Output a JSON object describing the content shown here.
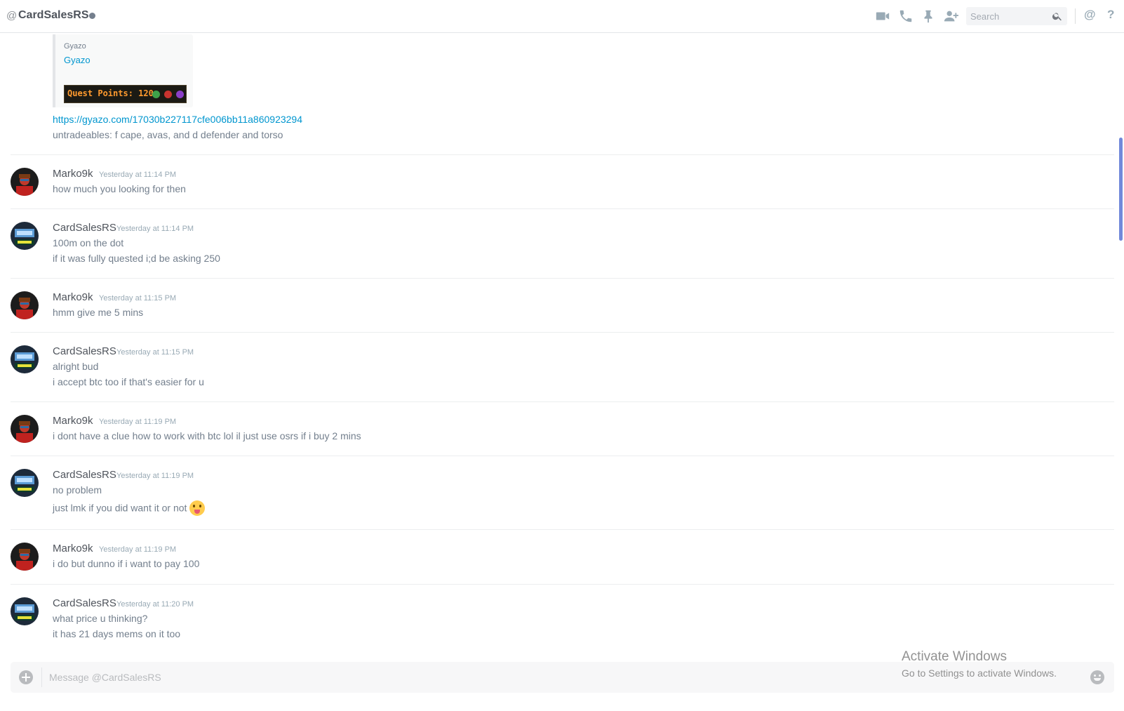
{
  "header": {
    "at_symbol": "@",
    "channel_name": "CardSalesRS",
    "search_placeholder": "Search",
    "mention_symbol": "@",
    "help_symbol": "?"
  },
  "embed": {
    "provider": "Gyazo",
    "title": "Gyazo",
    "thumbnail_text": "Quest Points: 120"
  },
  "prev_lines": {
    "link": "https://gyazo.com/17030b227117cfe006bb11a860923294",
    "text": "untradeables: f cape, avas, and d defender and torso"
  },
  "messages": [
    {
      "author": "Marko9k",
      "time": "Yesterday at 11:14 PM",
      "lines": [
        "how much you looking for then"
      ]
    },
    {
      "author": "CardSalesRS",
      "time": "Yesterday at 11:14 PM",
      "lines": [
        "100m on the dot",
        "if it was fully quested i;d be asking 250"
      ]
    },
    {
      "author": "Marko9k",
      "time": "Yesterday at 11:15 PM",
      "lines": [
        "hmm give me 5 mins"
      ]
    },
    {
      "author": "CardSalesRS",
      "time": "Yesterday at 11:15 PM",
      "lines": [
        "alright bud",
        "i accept btc too if that's easier for u"
      ]
    },
    {
      "author": "Marko9k",
      "time": "Yesterday at 11:19 PM",
      "lines": [
        "i dont have a clue how to work with btc lol il just use osrs if i buy 2 mins"
      ]
    },
    {
      "author": "CardSalesRS",
      "time": "Yesterday at 11:19 PM",
      "lines": [
        "no problem",
        "just lmk if you did want it or not"
      ]
    },
    {
      "author": "Marko9k",
      "time": "Yesterday at 11:19 PM",
      "lines": [
        "i do but dunno if i want to pay 100"
      ]
    },
    {
      "author": "CardSalesRS",
      "time": "Yesterday at 11:20 PM",
      "lines": [
        "what price u thinking?",
        "it has 21 days mems on it too"
      ]
    }
  ],
  "composer": {
    "placeholder": "Message @CardSalesRS"
  },
  "watermark": {
    "title": "Activate Windows",
    "subtitle": "Go to Settings to activate Windows."
  },
  "icons": {
    "video": "video-camera-icon",
    "call": "phone-icon",
    "pin": "pin-icon",
    "add_friend": "add-friend-icon",
    "search": "search-icon",
    "emoji": "tongue-out-emoji-icon"
  },
  "colors": {
    "link": "#0096cf",
    "scroll_accent": "#7289da",
    "status_offline": "#747f8d"
  }
}
